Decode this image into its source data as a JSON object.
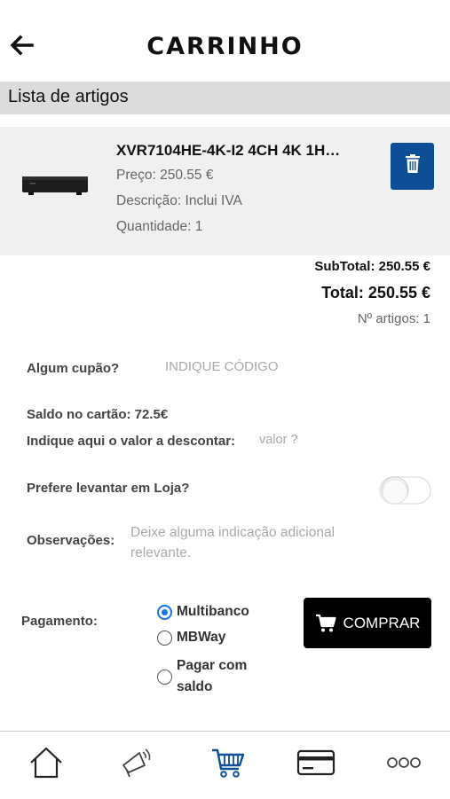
{
  "header": {
    "title": "CARRINHO"
  },
  "section": {
    "title": "Lista de artigos"
  },
  "item": {
    "name": "XVR7104HE-4K-I2 4CH 4K 1H…",
    "price": "Preço: 250.55 €",
    "description": "Descrição: Inclui IVA",
    "quantity": "Quantidade: 1"
  },
  "totals": {
    "subtotal": "SubTotal: 250.55 €",
    "total": "Total: 250.55 €",
    "count": "Nº artigos: 1"
  },
  "coupon": {
    "label": "Algum cupão?",
    "placeholder": "INDIQUE CÓDIGO"
  },
  "balance": {
    "label": "Saldo no cartão: 72.5€",
    "discount_label": "Indique aqui o valor a descontar:",
    "discount_placeholder": "valor ?"
  },
  "store_pickup": {
    "label": "Prefere levantar em Loja?",
    "enabled": false
  },
  "notes": {
    "label": "Observações:",
    "placeholder": "Deixe alguma indicação adicional relevante."
  },
  "payment": {
    "label": "Pagamento:",
    "options": [
      {
        "label": "Multibanco",
        "selected": true
      },
      {
        "label": "MBWay",
        "selected": false
      },
      {
        "label": "Pagar com saldo",
        "selected": false
      }
    ]
  },
  "buy_button": {
    "label": "COMPRAR"
  },
  "colors": {
    "accent": "#0e4e96",
    "radio": "#1a73e8",
    "buy": "#000000"
  },
  "nav": [
    {
      "icon": "home-icon"
    },
    {
      "icon": "megaphone-icon"
    },
    {
      "icon": "cart-icon",
      "active": true
    },
    {
      "icon": "card-icon"
    },
    {
      "icon": "more-icon"
    }
  ]
}
